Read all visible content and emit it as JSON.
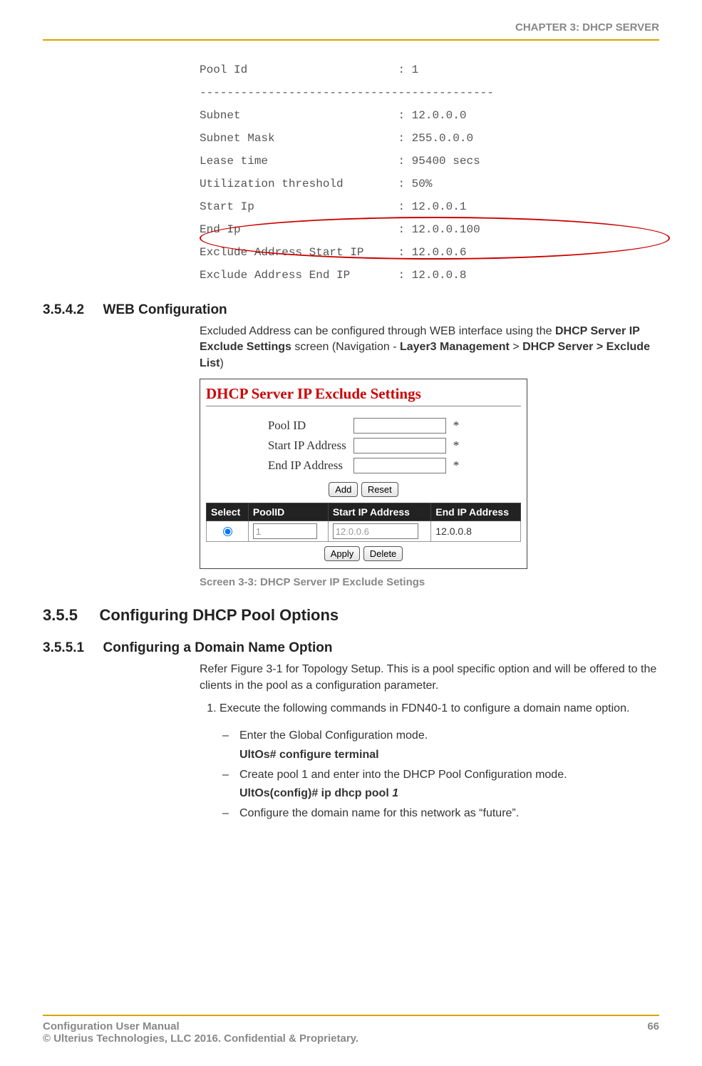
{
  "header": {
    "chapter": "CHAPTER 3: DHCP SERVER"
  },
  "mono": {
    "l1": "Pool Id                      : 1",
    "l2": "-------------------------------------------",
    "l3": "Subnet                       : 12.0.0.0",
    "l4": "Subnet Mask                  : 255.0.0.0",
    "l5": "Lease time                   : 95400 secs",
    "l6": "Utilization threshold        : 50%",
    "l7": "Start Ip                     : 12.0.0.1",
    "l8": "End Ip                       : 12.0.0.100",
    "l9": "Exclude Address Start IP     : 12.0.0.6",
    "l10": "Exclude Address End IP       : 12.0.0.8"
  },
  "sections": {
    "s1_num": "3.5.4.2",
    "s1_title": "WEB Configuration",
    "s1_para_a": "Excluded Address can be configured through WEB interface using the ",
    "s1_para_b1": "DHCP Server IP Exclude Settings",
    "s1_para_c": " screen (Navigation - ",
    "s1_para_b2": "Layer3 Management",
    "s1_para_d": " > ",
    "s1_para_b3": "DHCP Server > Exclude List",
    "s1_para_e": ")"
  },
  "screenshot": {
    "title": "DHCP Server IP Exclude Settings",
    "labels": {
      "pool": "Pool ID",
      "start": "Start IP Address",
      "end": "End IP Address"
    },
    "asterisk": "*",
    "buttons": {
      "add": "Add",
      "reset": "Reset",
      "apply": "Apply",
      "delete": "Delete"
    },
    "cols": {
      "select": "Select",
      "poolid": "PoolID",
      "start": "Start IP Address",
      "end": "End IP Address"
    },
    "row": {
      "poolid": "1",
      "start": "12.0.0.6",
      "end": "12.0.0.8"
    }
  },
  "caption": "Screen 3-3: DHCP Server IP Exclude Setings",
  "sec2": {
    "num": "3.5.5",
    "title": "Configuring DHCP Pool Options",
    "sub_num": "3.5.5.1",
    "sub_title": "Configuring a Domain Name Option",
    "para": "Refer Figure 3-1 for Topology Setup. This is a pool specific option and will be offered to the clients in the pool as a configuration parameter.",
    "step1": "Execute the following commands in FDN40-1 to configure a domain name option.",
    "sub_a": "Enter the Global Configuration mode.",
    "cmd_a": "UltOs# configure terminal",
    "sub_b": "Create pool 1 and enter into the DHCP Pool Configuration mode.",
    "cmd_b_prefix": "UltOs(config)# ip dhcp pool ",
    "cmd_b_arg": "1",
    "sub_c": "Configure the domain name for this network as “future”."
  },
  "footer": {
    "left1": "Configuration User Manual",
    "right": "66",
    "left2": "© Ulterius Technologies, LLC 2016. Confidential & Proprietary."
  }
}
